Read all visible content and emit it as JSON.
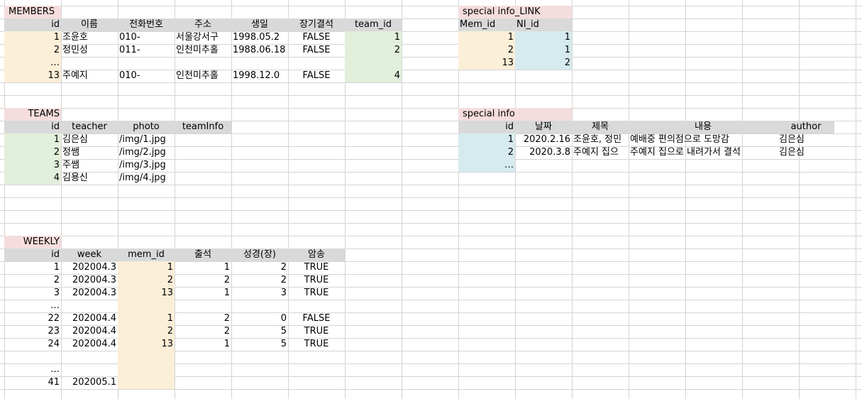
{
  "members": {
    "title": "MEMBERS",
    "headers": [
      "id",
      "이름",
      "전화번호",
      "주소",
      "생일",
      "장기결석",
      "team_id"
    ],
    "rows": [
      [
        "1",
        "조윤호",
        "010-",
        "서울강서구",
        "1998.05.2",
        "FALSE",
        "1"
      ],
      [
        "2",
        "정민성",
        "011-",
        "인천미추홀",
        "1988.06.18",
        "FALSE",
        "2"
      ],
      [
        "…",
        "",
        "",
        "",
        "",
        "",
        ""
      ],
      [
        "13",
        "주예지",
        "010-",
        "인천미추홀",
        "1998.12.0",
        "FALSE",
        "4"
      ]
    ]
  },
  "special_link": {
    "title": "special info_LINK",
    "headers": [
      "Mem_id",
      "NI_id"
    ],
    "rows": [
      [
        "1",
        "1"
      ],
      [
        "2",
        "1"
      ],
      [
        "13",
        "2"
      ]
    ]
  },
  "teams": {
    "title": "TEAMS",
    "headers": [
      "id",
      "teacher",
      "photo",
      "teamInfo"
    ],
    "rows": [
      [
        "1",
        "김은심",
        "/img/1.jpg",
        ""
      ],
      [
        "2",
        "정쌤",
        "/img/2.jpg",
        ""
      ],
      [
        "3",
        "주쌤",
        "/img/3.jpg",
        ""
      ],
      [
        "4",
        "김용신",
        "/img/4.jpg",
        ""
      ]
    ]
  },
  "special_info": {
    "title": "special info",
    "headers": [
      "id",
      "날짜",
      "제목",
      "내용",
      "author"
    ],
    "rows": [
      [
        "1",
        "2020.2.16",
        "조윤호, 정민",
        "예배중 편의점으로 도망감",
        "김은심"
      ],
      [
        "2",
        "2020.3.8",
        "주예지 집으",
        "주예지 집으로 내려가서 결석",
        "김은심"
      ],
      [
        "…",
        "",
        "",
        "",
        ""
      ]
    ]
  },
  "weekly": {
    "title": "WEEKLY",
    "headers": [
      "id",
      "week",
      "mem_id",
      "출석",
      "성경(장)",
      "암송"
    ],
    "rows": [
      [
        "1",
        "202004.3",
        "1",
        "1",
        "2",
        "TRUE"
      ],
      [
        "2",
        "202004.3",
        "2",
        "2",
        "2",
        "TRUE"
      ],
      [
        "3",
        "202004.3",
        "13",
        "1",
        "3",
        "TRUE"
      ],
      [
        "…",
        "",
        "",
        "",
        "",
        ""
      ],
      [
        "22",
        "202004.4",
        "1",
        "2",
        "0",
        "FALSE"
      ],
      [
        "23",
        "202004.4",
        "2",
        "2",
        "5",
        "TRUE"
      ],
      [
        "24",
        "202004.4",
        "13",
        "1",
        "5",
        "TRUE"
      ],
      [
        "",
        "",
        "",
        "",
        "",
        ""
      ],
      [
        "…",
        "",
        "",
        "",
        "",
        ""
      ],
      [
        "41",
        "202005.1",
        "",
        "",
        "",
        ""
      ]
    ]
  },
  "colors": {
    "title_fill": "#f6dddd",
    "header_fill": "#d9d9d9",
    "peach_fill": "#fcefd8",
    "green_fill": "#e2efda",
    "blue_fill": "#d6ebf0",
    "gridline": "#d4d4d4"
  }
}
